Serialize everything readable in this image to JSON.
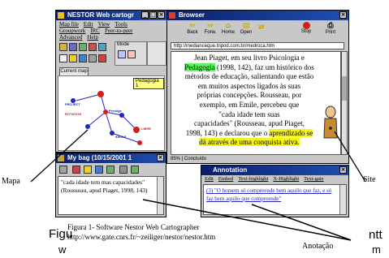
{
  "nestor_window": {
    "title": "NESTOR Web cartogr",
    "menu_row1": [
      "Map file",
      "Edit",
      "View",
      "Tools"
    ],
    "menu_row2": [
      "Groupwork",
      "IRC",
      "Peer-to-peer"
    ],
    "menu_row3": [
      "Advanced",
      "Help"
    ],
    "mode_label": "Mode",
    "tab_label": "Current map",
    "map_title_badge": "Pedagogia 1",
    "map_nodes": [
      "PROJECT",
      "ROTATION",
      "Prestige",
      "LIBRE",
      "IDEIAS"
    ]
  },
  "browser_window": {
    "title": "Browser",
    "toolbar": [
      "Back",
      "Forw.",
      "Home",
      "Open",
      "Stop",
      "Print"
    ],
    "url": "http://medianceque.tripod.com.br/medroca.htm",
    "body_lines": [
      [
        "Jean Piaget, em seu livro Psicologia e"
      ],
      [
        "@Pedagogia",
        " (1998, 142), faz um histórico dos"
      ],
      [
        "métodos de educação, salientando que estão"
      ],
      [
        "em muitos aspectos ligados às suas"
      ],
      [
        "próprias concepções. Rousseau, por"
      ],
      [
        "exemplo, em Emile, percebeu que"
      ],
      [
        "\"cada idade tem suas"
      ],
      [
        "capacidades\" (Rousseau, apud Piaget,"
      ],
      [
        "1998, 143) e declarou que o ",
        "#aprendizado se"
      ],
      [
        "#dá através de uma conquista ativa."
      ]
    ],
    "status": "85% | Concluído"
  },
  "bag_window": {
    "title": "My bag (10/15/2001 1",
    "quote": "\"cada idade tem mas capacidades\" (Rousseau, apud Piaget, 1998, 143)"
  },
  "annotation_window": {
    "title": "Annotation",
    "menu": [
      "Edit",
      "Embed",
      "Text-highlight",
      "X-Highlight",
      "Text-gate"
    ],
    "text": "(3) \"O homem só compreende bem aquilo que faz, e só faz bem aquilo que compreende\""
  },
  "labels": {
    "mapa": "Mapa",
    "site": "Site",
    "anotacao": "Anotação"
  },
  "caption": {
    "line1": "Figura 1- Software Nestor Web Cartographer",
    "line2": "http://www.gate.cnrs.fr/~zeiliger/nestor/nestor.htm",
    "left_fragment": "Figu",
    "left_fragment2": "w",
    "right_fragment": "ntt",
    "right_fragment2": "m"
  },
  "colors": {
    "titlebar": "#0a1f6b",
    "window_bg": "#c8c8c8",
    "highlight_green": "#5ef55e",
    "highlight_yellow": "#f5f51e",
    "node_red": "#d81b1b",
    "link_blue": "#2323c8"
  }
}
